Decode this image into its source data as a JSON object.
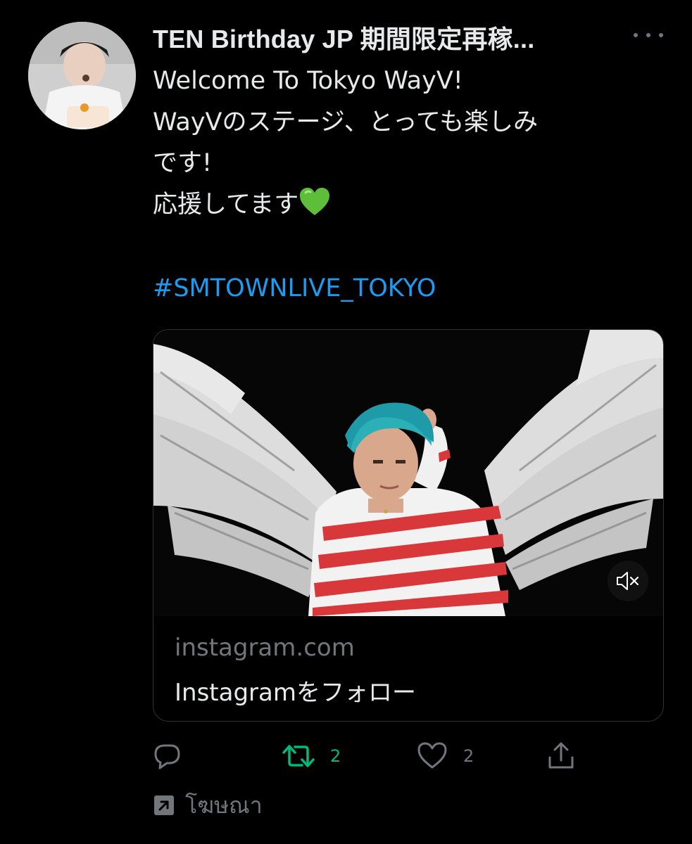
{
  "tweet": {
    "display_name": "TEN Birthday JP 期間限定再稼...",
    "lines": [
      "Welcome To Tokyo WayV!",
      "WayVのステージ、とっても楽しみ",
      "です!",
      "応援してます"
    ],
    "emoji": "green-heart",
    "hashtag": "#SMTOWNLIVE_TOKYO",
    "card": {
      "domain": "instagram.com",
      "title": "Instagramをフォロー",
      "media": "video: performer with blue hair and white wings in red-and-white striped outfit"
    },
    "actions": {
      "reply_count": "",
      "retweet_count": "2",
      "like_count": "2"
    },
    "ad_label": "โฆษณา"
  },
  "colors": {
    "background": "#000000",
    "text": "#e7e9ea",
    "secondary": "#71767b",
    "link": "#1d9bf0",
    "retweet": "#00ba7c",
    "heart": "#5dbe3a"
  },
  "icons": [
    "more-icon",
    "reply-icon",
    "retweet-icon",
    "like-icon",
    "share-icon",
    "mute-icon",
    "promoted-icon"
  ]
}
